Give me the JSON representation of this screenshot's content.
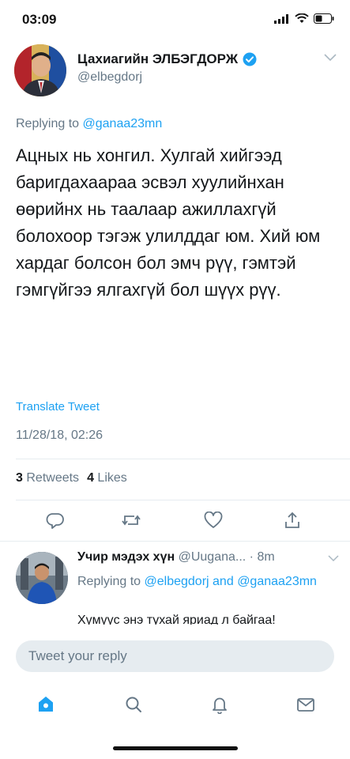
{
  "status_bar": {
    "time": "03:09"
  },
  "tweet": {
    "author_name": "Цахиагийн ЭЛБЭГДОРЖ",
    "author_handle": "@elbegdorj",
    "replying_prefix": "Replying to",
    "replying_to": "@ganaa23mn",
    "text": "Ацных нь хонгил. Хулгай хийгээд баригдахаараа эсвэл хуулийнхан өөрийнх нь таалаар ажиллахгүй болохоор тэгэж улилддаг юм. Хий юм хардаг болсон бол эмч рүү, гэмтэй гэмгүйгээ ялгахгүй бол шүүх рүү.",
    "translate_label": "Translate Tweet",
    "timestamp": "11/28/18, 02:26",
    "retweets_count": "3",
    "retweets_label": "Retweets",
    "likes_count": "4",
    "likes_label": "Likes"
  },
  "reply": {
    "author_name": "Учир мэдэх хүн",
    "author_handle": "@Uugana...",
    "time": "· 8m",
    "replying_prefix": "Replying to",
    "replying_to_1": "@elbegdorj",
    "replying_and": "and",
    "replying_to_2": "@ganaa23mn",
    "text": "Хүмүүс энэ тухай яриад л байгаа!"
  },
  "compose": {
    "placeholder": "Tweet your reply"
  },
  "icons": {
    "verified": "verified-badge-icon",
    "chevron": "chevron-down-icon",
    "reply": "reply-icon",
    "retweet": "retweet-icon",
    "like": "heart-icon",
    "share": "share-icon",
    "home": "home-icon",
    "search": "search-icon",
    "notifications": "bell-icon",
    "messages": "mail-icon"
  },
  "colors": {
    "accent": "#1da1f2",
    "secondary_text": "#657786",
    "divider": "#e6ecf0"
  }
}
